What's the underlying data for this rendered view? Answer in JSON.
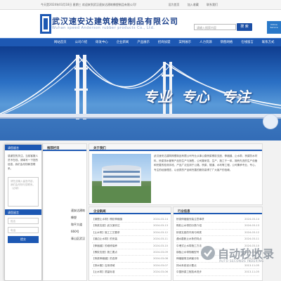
{
  "topbar": {
    "greeting": "今天是2024年03月18日 星期三 欢迎来到武汉速安达建筑橡塑制品有限公司!",
    "links": [
      "设为首页",
      "加入收藏",
      "联系我们"
    ]
  },
  "header": {
    "company_cn": "武汉速安达建筑橡塑制品有限公司",
    "company_en": "Wuhan speed Anderson rubber products Co., Ltd.",
    "search_placeholder": "请输入搜索内容",
    "search_button": "搜 索",
    "online_service": "Online Service"
  },
  "nav": [
    "网站首页",
    "公司介绍",
    "研发中心",
    "企业新闻",
    "产品展示",
    "招商加盟",
    "案例展示",
    "人力资源",
    "销售网络",
    "在线留言",
    "联系方式"
  ],
  "banner": {
    "slogans": [
      "专业",
      "专心",
      "专注"
    ]
  },
  "message_panel": {
    "title": "请您留言",
    "intro": "感谢您的关注，当前客服人员不在线，请填写一下您的信息，我们会尽快和您联系。",
    "content_placeholder": "请在此输入留言内容，我们会尽快与您联系。（必填）",
    "contact_title": "请您留言",
    "name_placeholder": "姓名",
    "phone_placeholder": "电话",
    "submit": "提交"
  },
  "recommend": {
    "title": "推荐栏目",
    "snippets": [
      "速安达建筑橡塑",
      "和平大道660号",
      "青山区武汉"
    ]
  },
  "about": {
    "title": "关于我们",
    "text": "武汉速安达建筑橡塑制品有限公司专业从事公路桥梁橡胶支座、伸缩缝、止水带、桥梁防水材料、桥梁排水管等产品的生产与销售，公司集研发、生产、施工于一体，拥有先进的生产设备和完善的检测手段，产品广泛应用于公路、桥梁、隧道、水利等工程。公司秉承专业、专心、专注的经营理念，以优质的产品和完善的服务赢得了广大客户的信赖。"
  },
  "news": {
    "title": "企业新闻",
    "items": [
      {
        "t": "【钢塑止水带】橡胶伸缩缝",
        "d": "2024-03-14"
      },
      {
        "t": "【桥梁支座】武汉速安达",
        "d": "2024-03-13"
      },
      {
        "t": "【止水带】施工工艺要求",
        "d": "2024-03-12"
      },
      {
        "t": "【钢边止水带】的安装",
        "d": "2024-03-11"
      },
      {
        "t": "【伸缩缝】的维修保养",
        "d": "2024-03-10"
      },
      {
        "t": "【橡胶支座】施工要点",
        "d": "2024-03-09"
      },
      {
        "t": "【桥梁伸缩缝】的选择",
        "d": "2024-03-08"
      },
      {
        "t": "【排水管】应用领域",
        "d": "2024-03-07"
      },
      {
        "t": "【止水带】质量标准",
        "d": "2024-03-06"
      }
    ]
  },
  "industry": {
    "title": "行业信息",
    "items": [
      {
        "t": "桥梁伸缩缝安装注意事项",
        "d": "2024-03-14"
      },
      {
        "t": "橡胶止水带的分类介绍",
        "d": "2024-03-13"
      },
      {
        "t": "桥梁支座的作用与种类",
        "d": "2024-03-12"
      },
      {
        "t": "遇水膨胀止水条的特点",
        "d": "2024-03-11"
      },
      {
        "t": "中埋式止水带施工方法",
        "d": "2024-03-10"
      },
      {
        "t": "钢板止水带规格型号",
        "d": "2024-03-09"
      },
      {
        "t": "伸缩缝常见病害分析",
        "d": "2024-03-08"
      },
      {
        "t": "排水系统设计要点",
        "d": "2013-11-05"
      },
      {
        "t": "中国桥梁工程技术进步",
        "d": "2013-11-05"
      }
    ]
  },
  "watermark": {
    "text": "自动秒收录",
    "sub": "AUTO SECONDS INDEXING"
  },
  "colors": {
    "brand_blue": "#1d58b3",
    "logo_blue": "#1a3f8a"
  }
}
